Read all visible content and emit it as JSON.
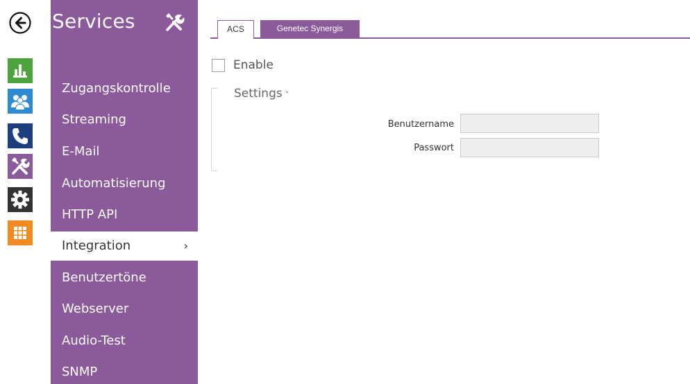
{
  "colors": {
    "brand_purple": "#8b5a9b",
    "rail_green": "#4ba43c",
    "rail_blue": "#2e8ad1",
    "rail_navy": "#1d3f80",
    "rail_dark": "#333333",
    "rail_orange": "#f28a22"
  },
  "rail": {
    "back_icon": "back-arrow-icon",
    "items": [
      {
        "icon": "status-chart-icon"
      },
      {
        "icon": "directory-users-icon"
      },
      {
        "icon": "calls-phone-icon"
      },
      {
        "icon": "services-tools-icon"
      },
      {
        "icon": "hardware-gear-icon"
      },
      {
        "icon": "system-grid-icon"
      }
    ]
  },
  "sidebar": {
    "title": "Services",
    "title_icon": "tools-icon",
    "items": [
      {
        "label": "Zugangskontrolle",
        "active": false
      },
      {
        "label": "Streaming",
        "active": false
      },
      {
        "label": "E-Mail",
        "active": false
      },
      {
        "label": "Automatisierung",
        "active": false
      },
      {
        "label": "HTTP API",
        "active": false
      },
      {
        "label": "Integration",
        "active": true,
        "chevron": "›"
      },
      {
        "label": "Benutzertöne",
        "active": false
      },
      {
        "label": "Webserver",
        "active": false
      },
      {
        "label": "Audio-Test",
        "active": false
      },
      {
        "label": "SNMP",
        "active": false
      }
    ]
  },
  "tabs": [
    {
      "label": "ACS",
      "selected": true
    },
    {
      "label": "Genetec Synergis",
      "selected": false
    }
  ],
  "content": {
    "enable": {
      "label": "Enable",
      "checked": false
    },
    "settings": {
      "header": "Settings",
      "chevron": "˅",
      "fields": [
        {
          "label": "Benutzername",
          "value": "",
          "placeholder": ""
        },
        {
          "label": "Passwort",
          "value": "",
          "placeholder": ""
        }
      ]
    }
  }
}
